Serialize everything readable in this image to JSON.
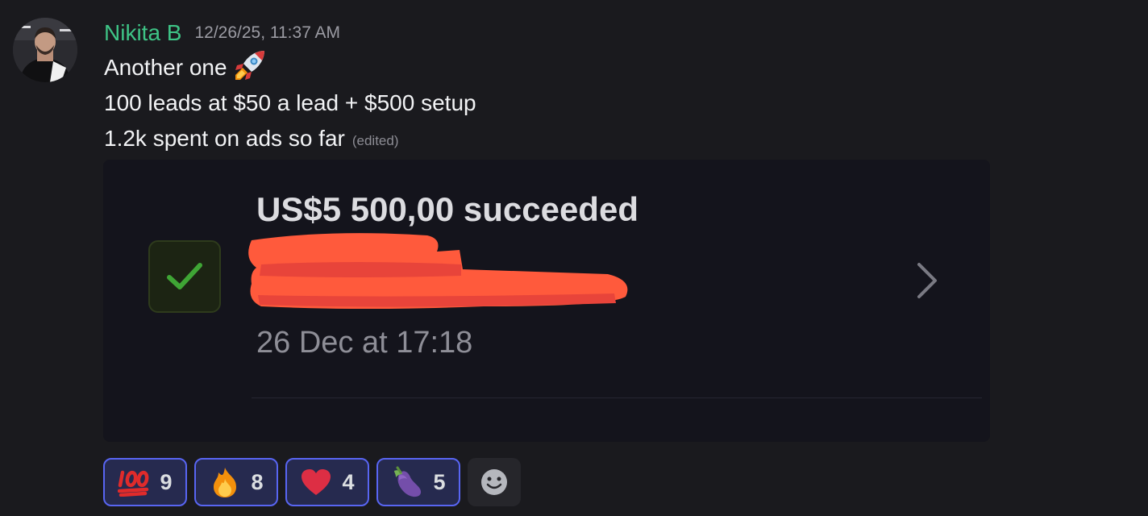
{
  "author": {
    "name": "Nikita B",
    "timestamp": "12/26/25, 11:37 AM",
    "name_color": "#3ec486"
  },
  "message": {
    "line1": "Another one",
    "line1_emoji": "rocket-emoji",
    "line2": "100 leads at $50 a lead + $500 setup",
    "line3": "1.2k spent on ads so far",
    "edited": "(edited)"
  },
  "attachment": {
    "amount_text": "US$5 500,00 succeeded",
    "date_text": "26 Dec at 17:18",
    "status_icon": "check-icon",
    "status_color": "#3fa535",
    "redaction_color": "#ff5a3c"
  },
  "reactions": [
    {
      "emoji": "hundred-points-emoji",
      "count": "9"
    },
    {
      "emoji": "fire-emoji",
      "count": "8"
    },
    {
      "emoji": "red-heart-emoji",
      "count": "4"
    },
    {
      "emoji": "eggplant-emoji",
      "count": "5"
    }
  ],
  "add_reaction_icon": "smiley-icon",
  "accent_color": "#5865f2"
}
